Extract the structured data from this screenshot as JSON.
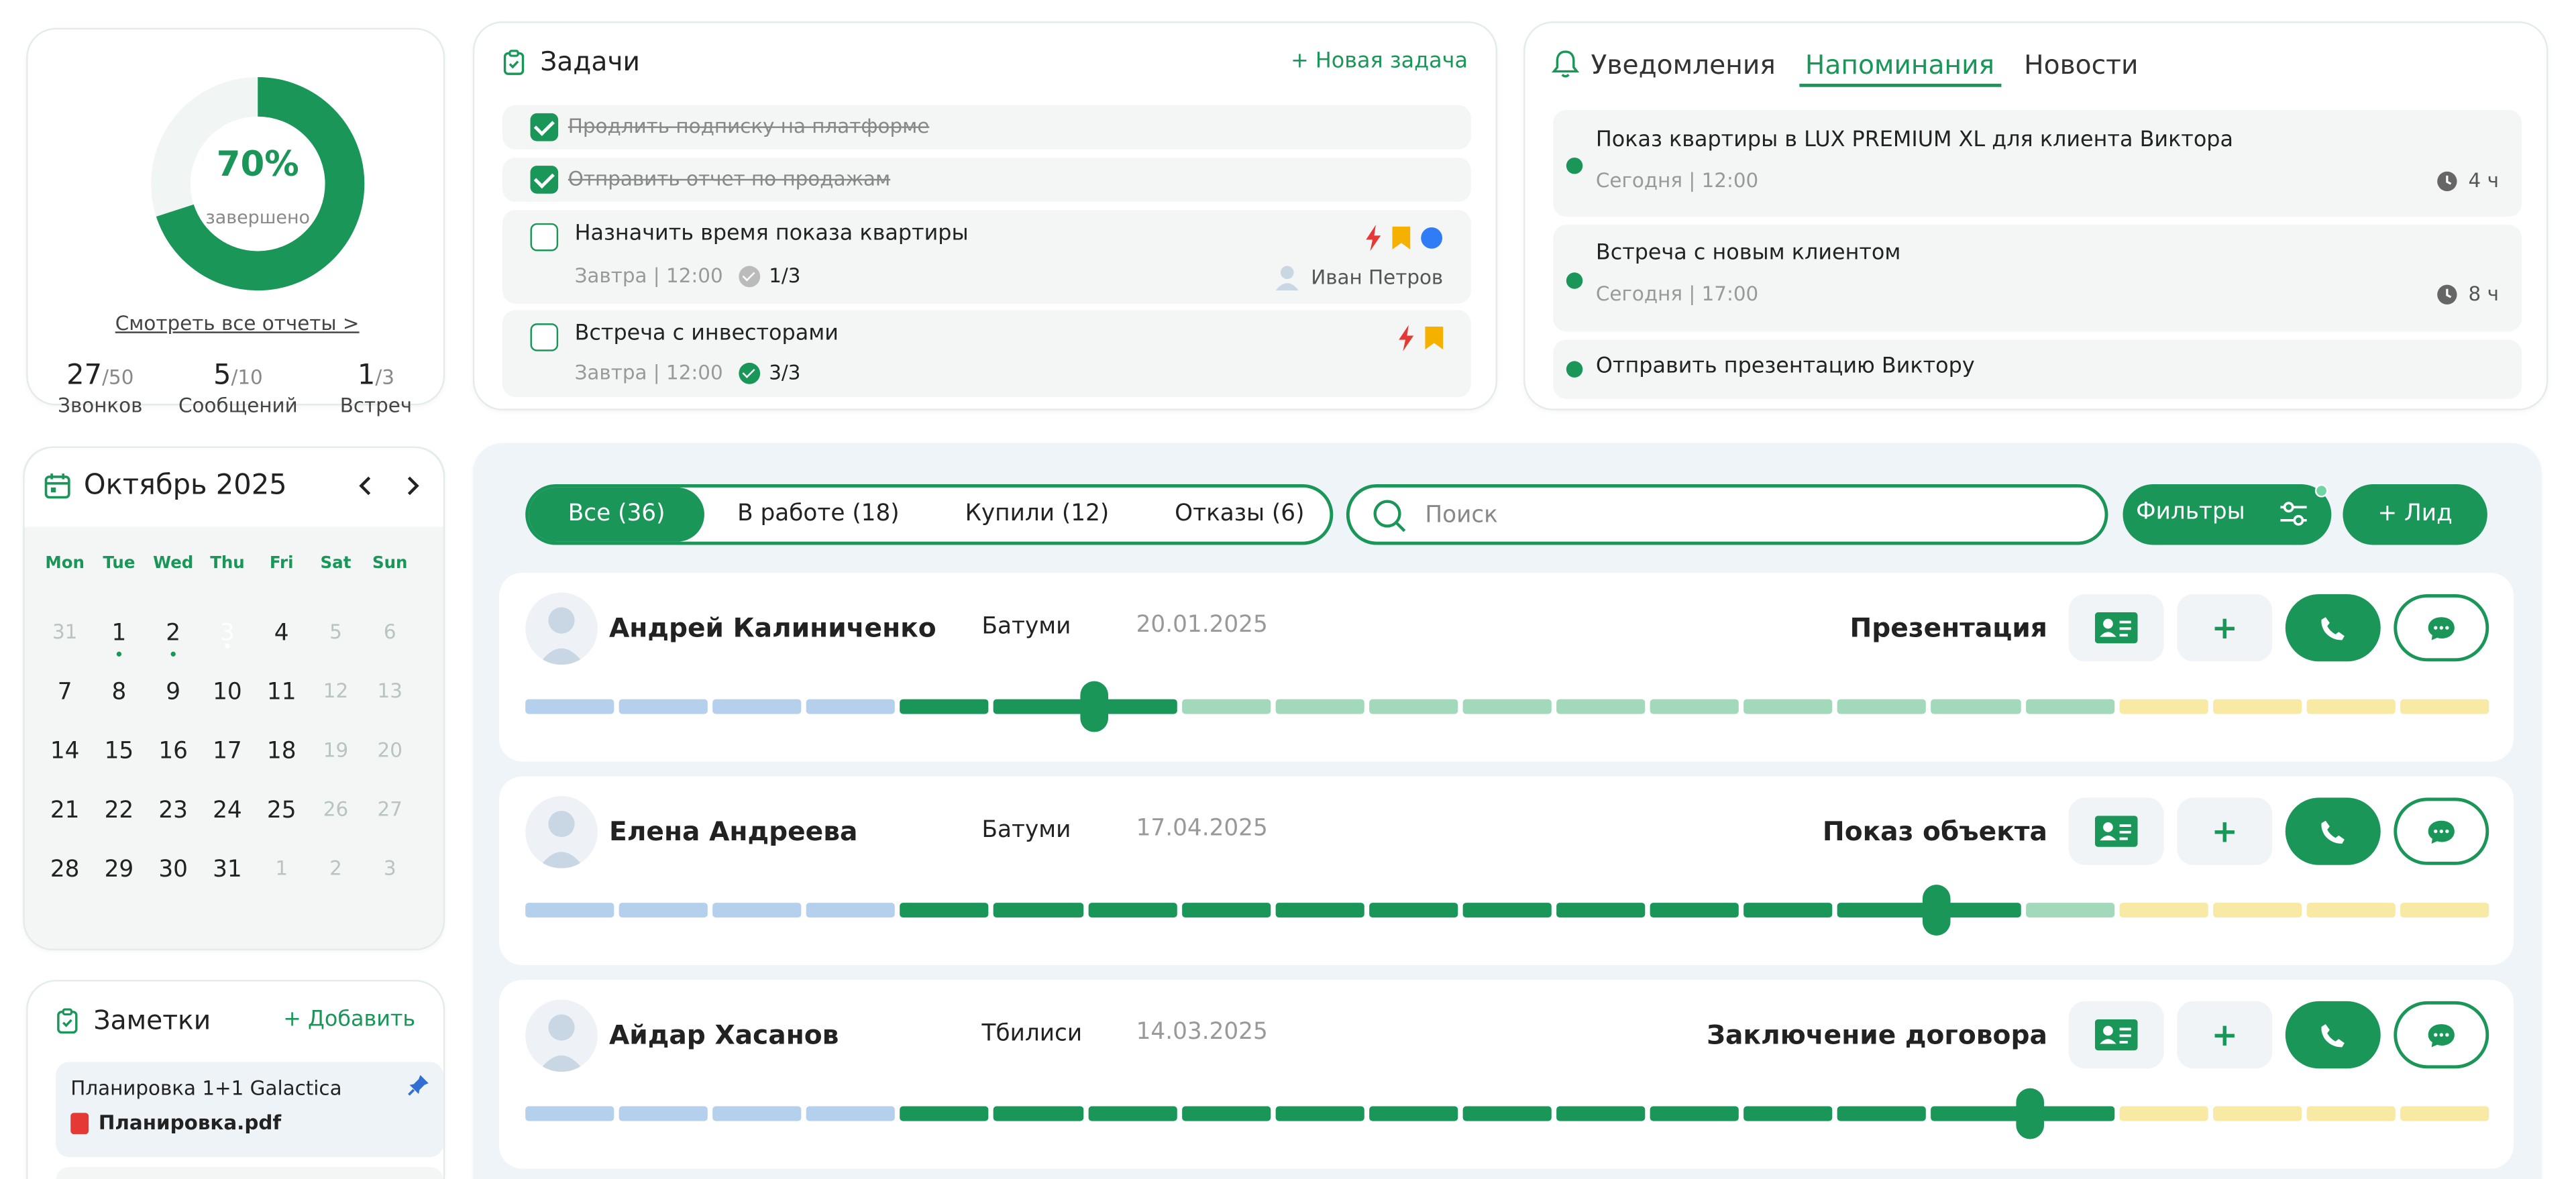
{
  "colors": {
    "accent": "#1a9658",
    "light_blue": "#b5d0ec",
    "light_green": "#a3d9bb",
    "light_yellow": "#f8e9a5",
    "done_gray": "#bbbbbb"
  },
  "stats": {
    "percent": "70%",
    "percent_value": 0.7,
    "percent_label": "завершено",
    "reports_link": "Смотреть все отчеты >",
    "kpis": [
      {
        "value": "27",
        "total": "/50",
        "label": "Звонков"
      },
      {
        "value": "5",
        "total": "/10",
        "label": "Сообщений"
      },
      {
        "value": "1",
        "total": "/3",
        "label": "Встреч"
      }
    ]
  },
  "tasks": {
    "title": "Задачи",
    "new_label": "+ Новая задача",
    "done": [
      {
        "text": "Продлить подписку на платформе"
      },
      {
        "text": "Отправить отчет по продажам"
      }
    ],
    "open": [
      {
        "text": "Назначить время показа квартиры",
        "meta": "Завтра | 12:00",
        "progress": "1/3",
        "progress_done": false,
        "assignee": "Иван Петров",
        "flags": [
          "lightning-icon",
          "bookmark-icon",
          "circle-icon"
        ]
      },
      {
        "text": "Встреча с инвесторами",
        "meta": "Завтра | 12:00",
        "progress": "3/3",
        "progress_done": true,
        "assignee": "",
        "flags": [
          "lightning-icon",
          "bookmark-icon"
        ]
      }
    ]
  },
  "notifications": {
    "tabs": [
      "Уведомления",
      "Напоминания",
      "Новости"
    ],
    "active_tab": 1,
    "items": [
      {
        "title": "Показ квартиры в LUX PREMIUM XL для клиента Виктора",
        "time": "Сегодня | 12:00",
        "badge": "4 ч"
      },
      {
        "title": "Встреча с новым клиентом",
        "time": "Сегодня | 17:00",
        "badge": "8 ч"
      },
      {
        "title": "Отправить презентацию Виктору",
        "time": "",
        "badge": ""
      }
    ]
  },
  "calendar": {
    "title": "Октябрь 2025",
    "weekdays": [
      "Mon",
      "Tue",
      "Wed",
      "Thu",
      "Fri",
      "Sat",
      "Sun"
    ],
    "weeks": [
      [
        {
          "d": "31",
          "f": true
        },
        {
          "d": "1",
          "m": true
        },
        {
          "d": "2",
          "m": true
        },
        {
          "d": "3",
          "t": true,
          "m": true
        },
        {
          "d": "4"
        },
        {
          "d": "5",
          "f": true
        },
        {
          "d": "6",
          "f": true
        }
      ],
      [
        {
          "d": "7"
        },
        {
          "d": "8"
        },
        {
          "d": "9"
        },
        {
          "d": "10"
        },
        {
          "d": "11"
        },
        {
          "d": "12",
          "f": true
        },
        {
          "d": "13",
          "f": true
        }
      ],
      [
        {
          "d": "14"
        },
        {
          "d": "15"
        },
        {
          "d": "16"
        },
        {
          "d": "17"
        },
        {
          "d": "18"
        },
        {
          "d": "19",
          "f": true
        },
        {
          "d": "20",
          "f": true
        }
      ],
      [
        {
          "d": "21"
        },
        {
          "d": "22"
        },
        {
          "d": "23"
        },
        {
          "d": "24"
        },
        {
          "d": "25"
        },
        {
          "d": "26",
          "f": true
        },
        {
          "d": "27",
          "f": true
        }
      ],
      [
        {
          "d": "28"
        },
        {
          "d": "29"
        },
        {
          "d": "30"
        },
        {
          "d": "31"
        },
        {
          "d": "1",
          "f": true
        },
        {
          "d": "2",
          "f": true
        },
        {
          "d": "3",
          "f": true
        }
      ]
    ]
  },
  "notes": {
    "title": "Заметки",
    "add_label": "+ Добавить",
    "items": [
      {
        "title": "Планировка 1+1 Galactica",
        "file": "Планировка.pdf"
      }
    ]
  },
  "leads": {
    "tabs": [
      {
        "label": "Все (36)"
      },
      {
        "label": "В работе (18)"
      },
      {
        "label": "Купили (12)"
      },
      {
        "label": "Отказы (6)"
      }
    ],
    "active_tab": 0,
    "search_placeholder": "Поиск",
    "filters_label": "Фильтры",
    "add_label": "+ Лид",
    "stage_scheme": [
      "blue",
      "blue",
      "blue",
      "blue",
      "green",
      "green",
      "green",
      "lgreen",
      "lgreen",
      "lgreen",
      "lgreen",
      "lgreen",
      "lgreen",
      "lgreen",
      "lgreen",
      "lgreen",
      "lgreen",
      "yellow",
      "yellow",
      "yellow",
      "yellow"
    ],
    "rows": [
      {
        "name": "Андрей Калиниченко",
        "city": "Батуми",
        "date": "20.01.2025",
        "stage": "Презентация",
        "progress_steps": 6,
        "knob_fraction": 0.289
      },
      {
        "name": "Елена Андреева",
        "city": "Батуми",
        "date": "17.04.2025",
        "stage": "Показ объекта",
        "progress_steps": 16,
        "knob_fraction": 0.718
      },
      {
        "name": "Айдар Хасанов",
        "city": "Тбилиси",
        "date": "14.03.2025",
        "stage": "Заключение договора",
        "progress_steps": 17,
        "knob_fraction": 0.766
      }
    ]
  }
}
